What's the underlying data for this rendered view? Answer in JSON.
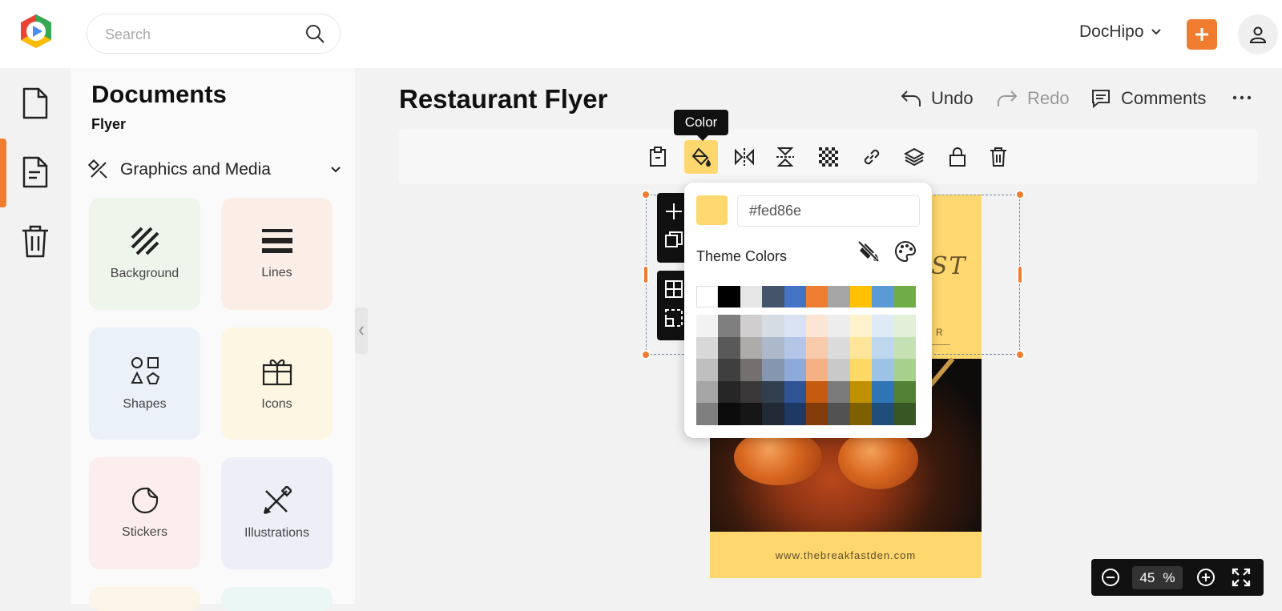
{
  "header": {
    "search_placeholder": "Search",
    "workspace": "DocHipo"
  },
  "panel": {
    "title": "Documents",
    "subtitle": "Flyer",
    "category": "Graphics and Media",
    "tiles": [
      {
        "label": "Background",
        "icon": "background-icon",
        "bg": "#eef5ea"
      },
      {
        "label": "Lines",
        "icon": "lines-icon",
        "bg": "#fbeee6"
      },
      {
        "label": "Shapes",
        "icon": "shapes-icon",
        "bg": "#eaf1f9"
      },
      {
        "label": "Icons",
        "icon": "gift-icon",
        "bg": "#fdf6e3"
      },
      {
        "label": "Stickers",
        "icon": "sticker-icon",
        "bg": "#fceeed"
      },
      {
        "label": "Illustrations",
        "icon": "illustrations-icon",
        "bg": "#eeeef9"
      }
    ]
  },
  "editor": {
    "title": "Restaurant Flyer",
    "undo": "Undo",
    "redo": "Redo",
    "comments": "Comments",
    "tooltip": "Color",
    "accent": "#f07c30"
  },
  "flyer": {
    "url": "www.thebreakfastden.com",
    "text_fragment": "ST",
    "text_fragment2": "R"
  },
  "color_popover": {
    "hex": "#fed86e",
    "theme_label": "Theme Colors",
    "base_colors": [
      "#ffffff",
      "#000000",
      "#e7e6e6",
      "#44546a",
      "#4472c4",
      "#ed7d31",
      "#a5a5a5",
      "#ffc000",
      "#5b9bd5",
      "#70ad47"
    ],
    "shade_rows": [
      [
        "#f2f2f2",
        "#7f7f7f",
        "#d0cece",
        "#d6dce4",
        "#d9e2f3",
        "#fbe5d5",
        "#ededed",
        "#fff2cc",
        "#deebf6",
        "#e2efd9"
      ],
      [
        "#d8d8d8",
        "#595959",
        "#aeabab",
        "#adb9ca",
        "#b4c6e7",
        "#f7cbac",
        "#dbdbdb",
        "#fee599",
        "#bdd7ee",
        "#c5e0b3"
      ],
      [
        "#bfbfbf",
        "#3f3f3f",
        "#757070",
        "#8496b0",
        "#8eaadb",
        "#f4b183",
        "#c9c9c9",
        "#ffd965",
        "#9cc3e5",
        "#a8d08d"
      ],
      [
        "#a5a5a5",
        "#262626",
        "#3a3838",
        "#323f4f",
        "#2f5496",
        "#c55a11",
        "#7b7b7b",
        "#bf9000",
        "#2e75b5",
        "#538135"
      ],
      [
        "#7f7f7f",
        "#0c0c0c",
        "#171616",
        "#222a35",
        "#1f3864",
        "#843c0b",
        "#525252",
        "#7f6000",
        "#1e4e79",
        "#375623"
      ]
    ]
  },
  "zoom": {
    "value": "45",
    "unit": "%"
  }
}
